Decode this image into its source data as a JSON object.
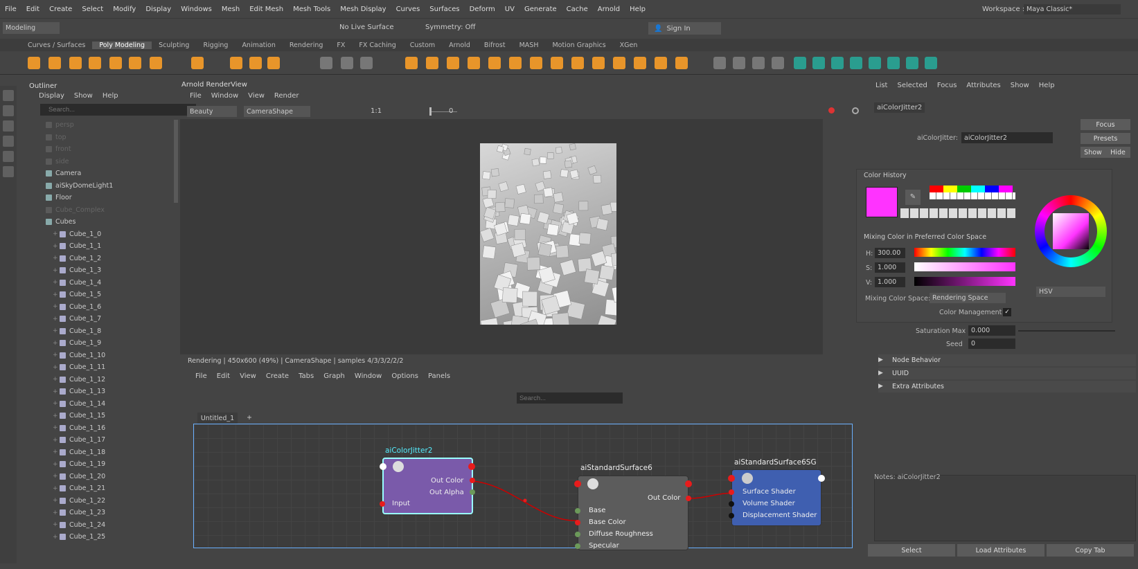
{
  "menu": [
    "File",
    "Edit",
    "Create",
    "Select",
    "Modify",
    "Display",
    "Windows",
    "Mesh",
    "Edit Mesh",
    "Mesh Tools",
    "Mesh Display",
    "Curves",
    "Surfaces",
    "Deform",
    "UV",
    "Generate",
    "Cache",
    "Arnold",
    "Help"
  ],
  "workspace": {
    "label": "Workspace :",
    "value": "Maya Classic*"
  },
  "status": {
    "mode": "Modeling",
    "live_surface": "No Live Surface",
    "symmetry": "Symmetry: Off",
    "sign_in": "Sign In"
  },
  "shelf_tabs": [
    "Curves / Surfaces",
    "Poly Modeling",
    "Sculpting",
    "Rigging",
    "Animation",
    "Rendering",
    "FX",
    "FX Caching",
    "Custom",
    "Arnold",
    "Bifrost",
    "MASH",
    "Motion Graphics",
    "XGen"
  ],
  "shelf_active": "Poly Modeling",
  "outliner": {
    "title": "Outliner",
    "menu": [
      "Display",
      "Show",
      "Help"
    ],
    "search_placeholder": "Search...",
    "items": [
      {
        "label": "persp",
        "dim": true
      },
      {
        "label": "top",
        "dim": true
      },
      {
        "label": "front",
        "dim": true
      },
      {
        "label": "side",
        "dim": true
      },
      {
        "label": "Camera",
        "dim": false
      },
      {
        "label": "aiSkyDomeLight1",
        "dim": false
      },
      {
        "label": "Floor",
        "dim": false
      },
      {
        "label": "Cube_Complex",
        "dim": true
      },
      {
        "label": "Cubes",
        "dim": false
      }
    ],
    "cubes": [
      "Cube_1_0",
      "Cube_1_1",
      "Cube_1_2",
      "Cube_1_3",
      "Cube_1_4",
      "Cube_1_5",
      "Cube_1_6",
      "Cube_1_7",
      "Cube_1_8",
      "Cube_1_9",
      "Cube_1_10",
      "Cube_1_11",
      "Cube_1_12",
      "Cube_1_13",
      "Cube_1_14",
      "Cube_1_15",
      "Cube_1_16",
      "Cube_1_17",
      "Cube_1_18",
      "Cube_1_19",
      "Cube_1_20",
      "Cube_1_21",
      "Cube_1_22",
      "Cube_1_23",
      "Cube_1_24",
      "Cube_1_25"
    ]
  },
  "renderview": {
    "title": "Arnold RenderView",
    "menu": [
      "File",
      "Window",
      "View",
      "Render"
    ],
    "aov": "Beauty",
    "camera": "CameraShape",
    "ratio": "1:1",
    "exposure": "0",
    "status": "Rendering | 450x600 (49%) | CameraShape | samples 4/3/3/2/2/2"
  },
  "nodeeditor": {
    "menu": [
      "File",
      "Edit",
      "View",
      "Create",
      "Tabs",
      "Graph",
      "Window",
      "Options",
      "Panels"
    ],
    "search_placeholder": "Search...",
    "tab": "Untitled_1",
    "tab_add": "+",
    "jitter": {
      "name": "aiColorJitter2",
      "out_color": "Out Color",
      "out_alpha": "Out Alpha",
      "input": "Input"
    },
    "surface": {
      "name": "aiStandardSurface6",
      "out_color": "Out Color",
      "ports": [
        "Base",
        "Base Color",
        "Diffuse Roughness",
        "Specular"
      ]
    },
    "sg": {
      "name": "aiStandardSurface6SG",
      "ports": [
        "Surface Shader",
        "Volume Shader",
        "Displacement Shader"
      ]
    }
  },
  "attr": {
    "menu": [
      "List",
      "Selected",
      "Focus",
      "Attributes",
      "Show",
      "Help"
    ],
    "tab": "aiColorJitter2",
    "node_label": "aiColorJitter:",
    "node_value": "aiColorJitter2",
    "focus": "Focus",
    "presets": "Presets",
    "show": "Show",
    "hide": "Hide",
    "saturation_label": "Saturation Max",
    "saturation_value": "0.000",
    "seed_label": "Seed",
    "seed_value": "0",
    "sections": [
      "Node Behavior",
      "UUID",
      "Extra Attributes"
    ],
    "notes": "Notes: aiColorJitter2",
    "bottom": [
      "Select",
      "Load Attributes",
      "Copy Tab"
    ]
  },
  "colorpicker": {
    "history_label": "Color History",
    "current_color": "#ff33ff",
    "mixing_label": "Mixing Color in Preferred Color Space",
    "h_label": "H:",
    "h": "300.00",
    "s_label": "S:",
    "s": "1.000",
    "v_label": "V:",
    "v": "1.000",
    "space_label": "Mixing Color Space:",
    "space": "Rendering Space",
    "mgmt": "Color Management",
    "mode": "HSV",
    "swatches": [
      "#ff0000",
      "#ffff00",
      "#00cc00",
      "#00ffff",
      "#0000ff",
      "#ff00ff"
    ]
  }
}
